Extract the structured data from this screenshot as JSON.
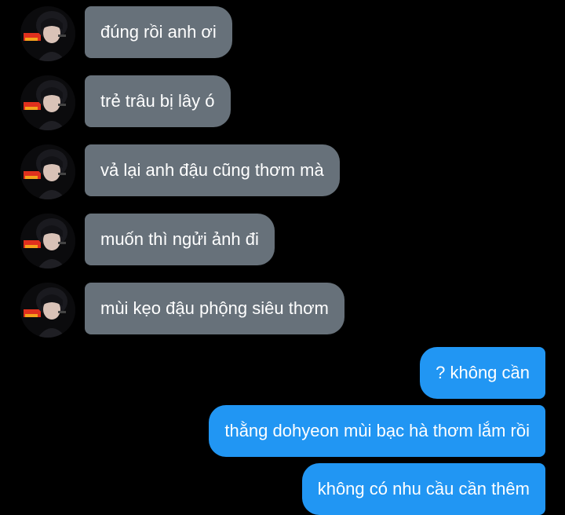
{
  "conversation": {
    "incoming": [
      {
        "text": "đúng rồi anh ơi"
      },
      {
        "text": "trẻ trâu bị lây ó"
      },
      {
        "text": "vả lại anh đậu cũng thơm mà"
      },
      {
        "text": "muốn thì ngửi ảnh đi"
      },
      {
        "text": "mùi kẹo đậu phộng siêu thơm"
      }
    ],
    "outgoing": [
      {
        "text": "? không cần"
      },
      {
        "text": "thằng dohyeon mùi bạc hà thơm lắm rồi"
      },
      {
        "text": "không có nhu cầu cần thêm"
      }
    ]
  },
  "colors": {
    "background": "#000000",
    "incoming_bubble": "#67717a",
    "outgoing_bubble": "#2196f3",
    "text": "#ffffff"
  },
  "icons": {
    "avatar": "contact-avatar-photo"
  }
}
